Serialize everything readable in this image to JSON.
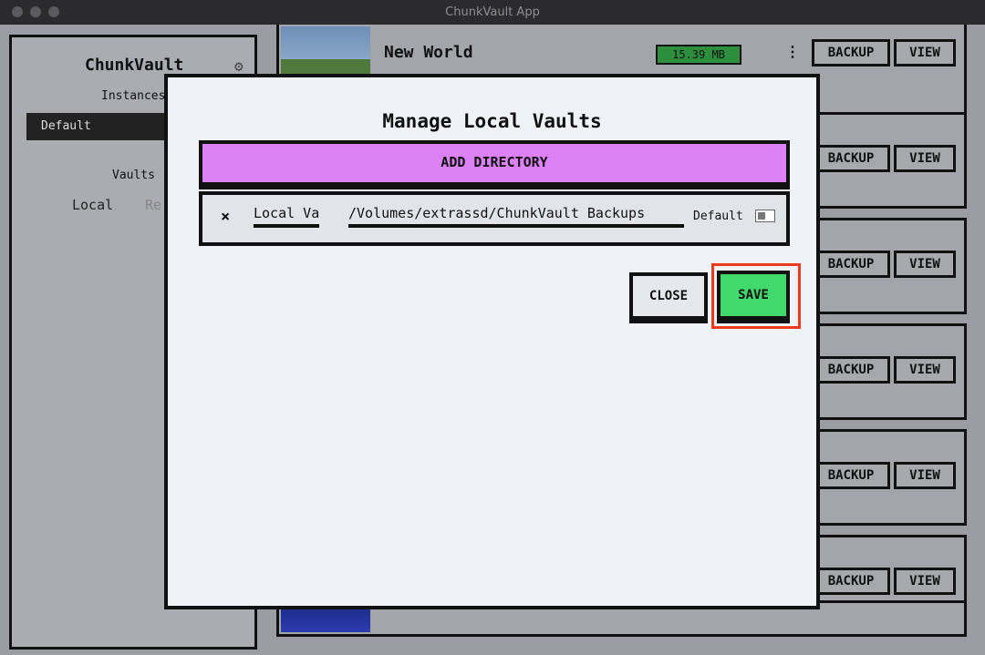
{
  "window": {
    "title": "ChunkVault App",
    "traffic_lights": [
      "close",
      "minimize",
      "zoom"
    ]
  },
  "sidebar": {
    "title": "ChunkVault",
    "settings_icon": "gear-icon",
    "instances_label": "Instances",
    "instance_selected": "Default",
    "vaults_label": "Vaults",
    "vault_tabs": [
      "Local",
      "Re"
    ]
  },
  "worlds": [
    {
      "name": "New World",
      "size": "15.39 MB",
      "backup_label": "BACKUP",
      "view_label": "VIEW"
    },
    {
      "backup_label": "BACKUP",
      "view_label": "VIEW"
    },
    {
      "backup_label": "BACKUP",
      "view_label": "VIEW"
    },
    {
      "backup_label": "BACKUP",
      "view_label": "VIEW"
    },
    {
      "backup_label": "BACKUP",
      "view_label": "VIEW"
    },
    {
      "backup_label": "BACKUP",
      "view_label": "VIEW"
    }
  ],
  "modal": {
    "title": "Manage Local Vaults",
    "add_directory_label": "ADD DIRECTORY",
    "vaults": [
      {
        "remove_symbol": "×",
        "name": "Local Vaul",
        "path": "/Volumes/extrassd/ChunkVault Backups",
        "default_label": "Default",
        "is_default": false
      }
    ],
    "close_label": "CLOSE",
    "save_label": "SAVE",
    "highlight_color": "#ee3a1c"
  },
  "colors": {
    "add_directory": "#dd82f6",
    "save": "#41d96b",
    "size_badge": "#2d8f3e"
  }
}
